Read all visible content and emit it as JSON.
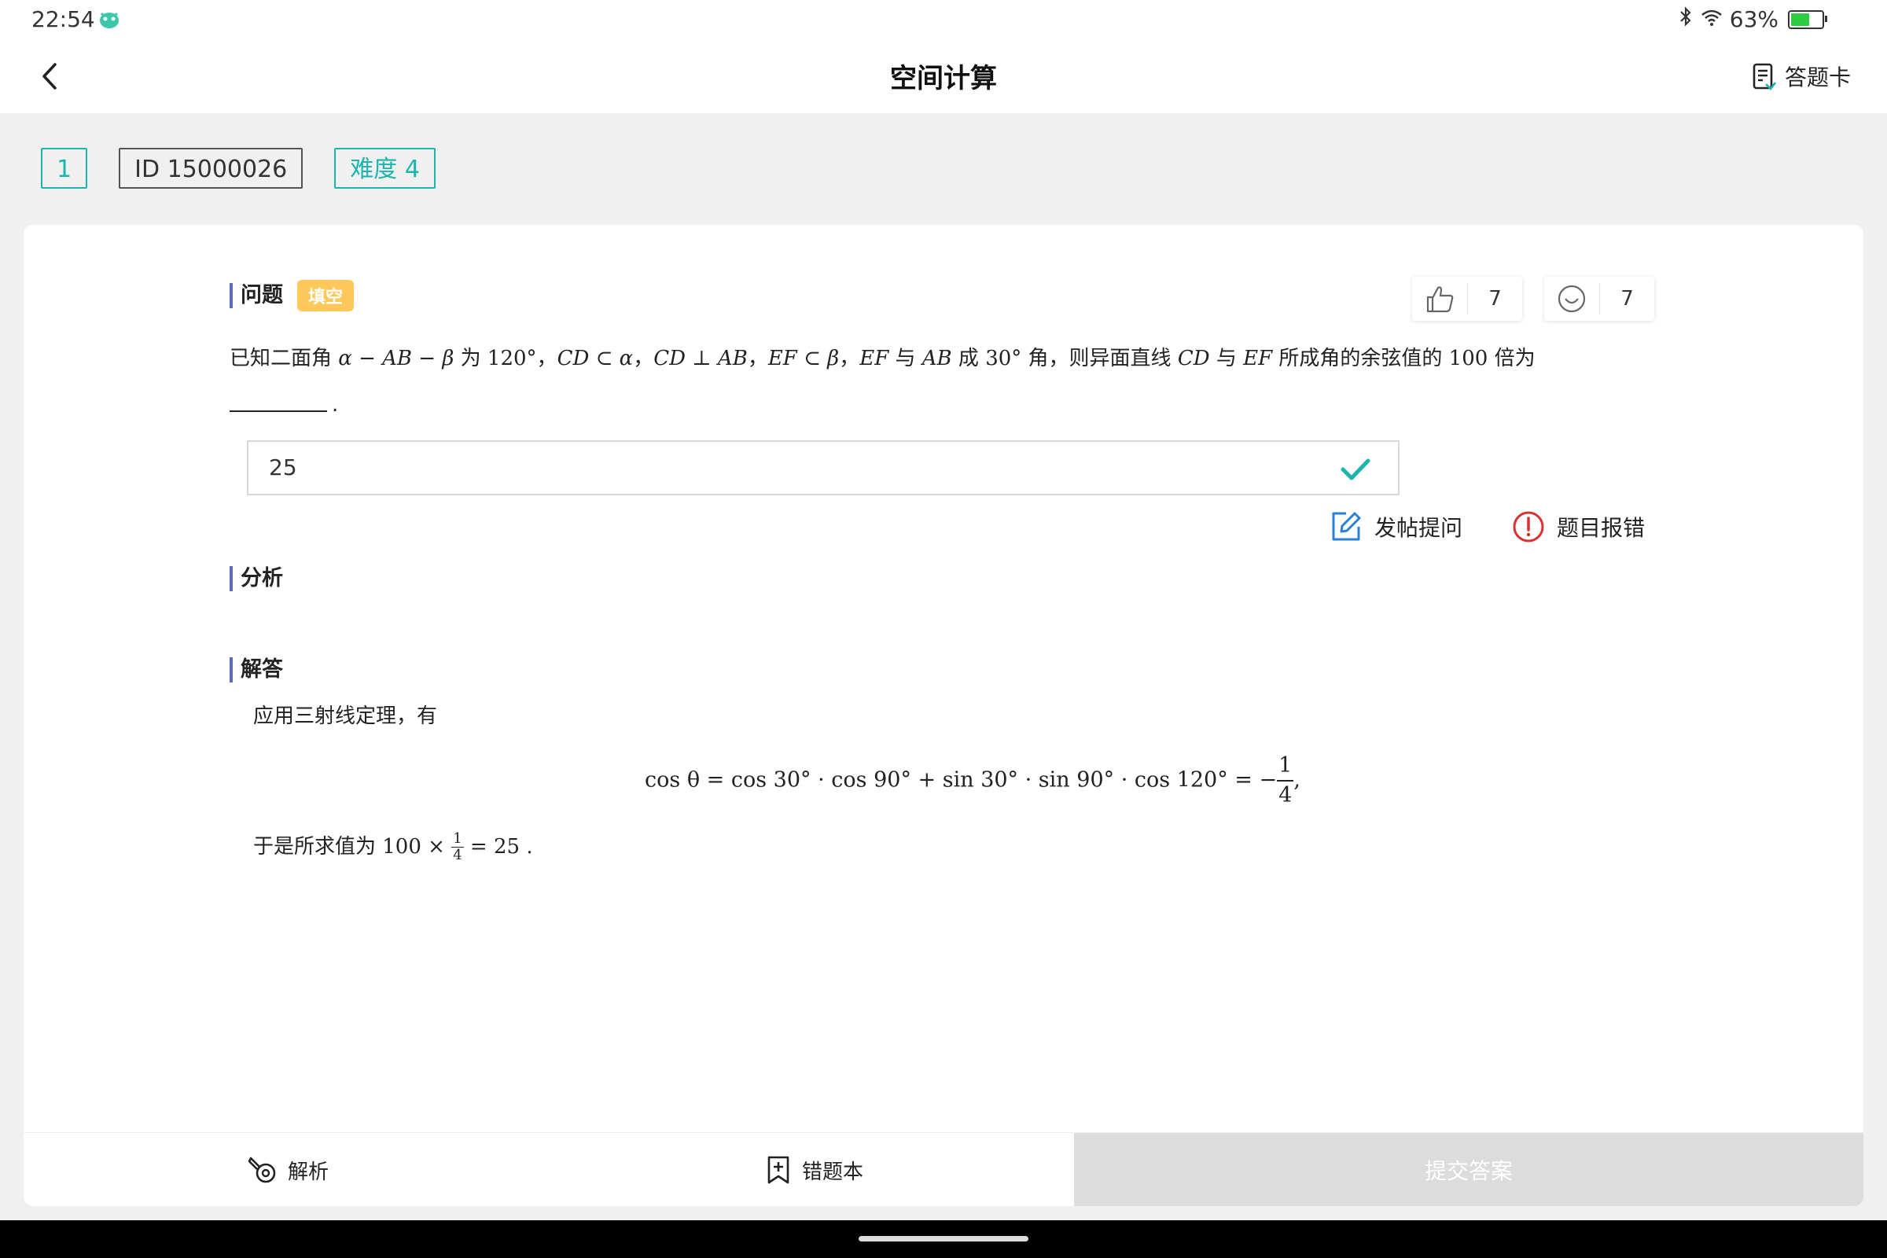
{
  "status_bar": {
    "time": "22:54",
    "battery_text": "63%",
    "battery_level": 0.63
  },
  "header": {
    "title": "空间计算",
    "answer_card_label": "答题卡"
  },
  "tags": {
    "index": "1",
    "id": "ID 15000026",
    "difficulty": "难度 4"
  },
  "question": {
    "section_label": "问题",
    "type_badge": "填空",
    "likes": "7",
    "smiles": "7",
    "text_parts": [
      "已知二面角 ",
      "α − AB − β",
      " 为 ",
      "120°",
      "，",
      "CD ⊂ α",
      "，",
      "CD ⊥ AB",
      "，",
      "EF ⊂ β",
      "，",
      "EF",
      " 与 ",
      "AB",
      " 成 ",
      "30°",
      " 角，则异面直线 ",
      "CD",
      " 与 ",
      "EF",
      " 所成角的余弦值的 ",
      "100",
      " 倍为"
    ],
    "blank_suffix": "."
  },
  "answer": {
    "value": "25"
  },
  "actions": {
    "post_question": "发帖提问",
    "report_error": "题目报错"
  },
  "analysis": {
    "section_label": "分析"
  },
  "solution": {
    "section_label": "解答",
    "intro": "应用三射线定理，有",
    "formula_lhs": "cos θ = cos 30° · cos 90° + sin 30° · sin 90° · cos 120° = −",
    "formula_frac_num": "1",
    "formula_frac_den": "4",
    "formula_tail": ",",
    "conclusion_prefix": "于是所求值为 ",
    "conclusion_mult": "100 × ",
    "conclusion_frac_num": "1",
    "conclusion_frac_den": "4",
    "conclusion_tail": " = 25 ."
  },
  "bottom_bar": {
    "analysis_label": "解析",
    "mistakes_label": "错题本",
    "submit_label": "提交答案"
  },
  "colors": {
    "accent": "#1cb5ae",
    "section_bar": "#5b6bc0",
    "badge": "#ffc85a",
    "check": "#1cb5ae",
    "report": "#d93030",
    "post": "#2b7fd4"
  }
}
